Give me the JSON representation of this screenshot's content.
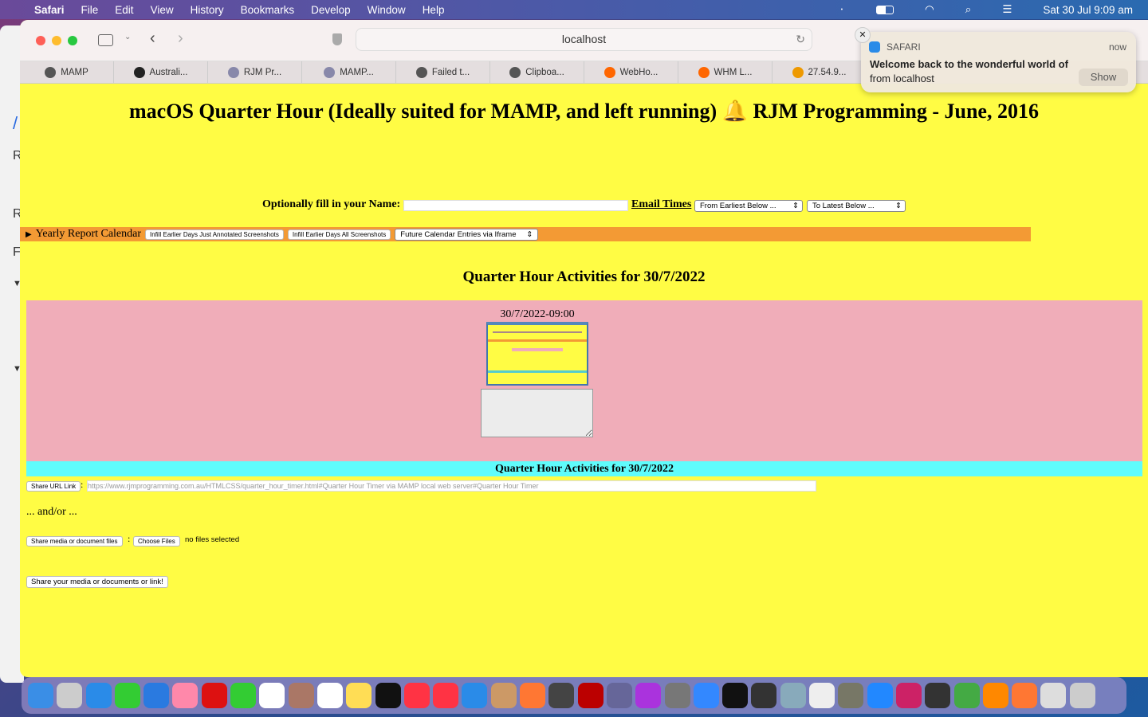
{
  "menubar": {
    "items": [
      "Safari",
      "File",
      "Edit",
      "View",
      "History",
      "Bookmarks",
      "Develop",
      "Window",
      "Help"
    ],
    "clock": "Sat 30 Jul  9:09 am"
  },
  "browser": {
    "url": "localhost",
    "tabs": [
      {
        "label": "MAMP",
        "icon": "mamp-icon",
        "color": "#555"
      },
      {
        "label": "Australi...",
        "icon": "s-icon",
        "color": "#222"
      },
      {
        "label": "RJM Pr...",
        "icon": "rjm-icon",
        "color": "#88a"
      },
      {
        "label": "MAMP...",
        "icon": "rjm-icon",
        "color": "#88a"
      },
      {
        "label": "Failed t...",
        "icon": "mamp-icon",
        "color": "#555"
      },
      {
        "label": "Clipboa...",
        "icon": "mamp-icon",
        "color": "#555"
      },
      {
        "label": "WebHo...",
        "icon": "cpanel-icon",
        "color": "#f60"
      },
      {
        "label": "WHM L...",
        "icon": "cpanel-icon",
        "color": "#f60"
      },
      {
        "label": "27.54.9...",
        "icon": "pma-icon",
        "color": "#e90"
      }
    ]
  },
  "notification": {
    "app": "SAFARI",
    "time": "now",
    "title": "Welcome back to the wonderful world of",
    "body": "from localhost",
    "show": "Show"
  },
  "page": {
    "title": "macOS Quarter Hour (Ideally suited for MAMP, and left running) 🔔 RJM Programming - June, 2016",
    "name_label": "Optionally fill in your Name:",
    "name_value": "",
    "email_link": "Email Times",
    "email_from": "From Earliest Below ...",
    "email_to": "To Latest Below ...",
    "calendar_label": "Yearly Report Calendar",
    "infill_annotated": "Infill Earlier Days Just Annotated Screenshots",
    "infill_all": "Infill Earlier Days All Screenshots",
    "future_select": "Future Calendar Entries via Iframe",
    "activities_heading": "Quarter Hour Activities for 30/7/2022",
    "entry_time": "30/7/2022-09:00",
    "cyan_heading": "Quarter Hour Activities for 30/7/2022",
    "share_url_btn": "Share URL Link",
    "share_url_value": "https://www.rjmprogramming.com.au/HTMLCSS/quarter_hour_timer.html#Quarter Hour Timer via MAMP local web server#Quarter Hour Timer",
    "andor": "... and/or ...",
    "share_media_btn": "Share media or document files",
    "choose_files": "Choose Files",
    "no_files": "no files selected",
    "share_submit": "Share your media or documents or link!",
    "colors": {
      "background": "#fffc44",
      "calendar_bar": "#f39a34",
      "entry_box": "#f0adb9",
      "cyan_bar": "#5ffcfc"
    }
  },
  "dock": [
    [
      "finder-icon",
      "#3a8ee6"
    ],
    [
      "launchpad-icon",
      "#ccc"
    ],
    [
      "safari-icon",
      "#2a8be8"
    ],
    [
      "messages-icon",
      "#3c3"
    ],
    [
      "mail-icon",
      "#2a7ae0"
    ],
    [
      "photos-icon",
      "#f8a"
    ],
    [
      "opera-icon",
      "#d11"
    ],
    [
      "facetime-icon",
      "#3c3"
    ],
    [
      "calendar-icon",
      "#fff"
    ],
    [
      "contacts-icon",
      "#a76"
    ],
    [
      "reminders-icon",
      "#fff"
    ],
    [
      "notes-icon",
      "#fd5"
    ],
    [
      "tv-icon",
      "#111"
    ],
    [
      "music-icon",
      "#f34"
    ],
    [
      "news-icon",
      "#f34"
    ],
    [
      "app-store-icon",
      "#2a8be8"
    ],
    [
      "paint-icon",
      "#c96"
    ],
    [
      "firefox-icon",
      "#f73"
    ],
    [
      "calculator-icon",
      "#444"
    ],
    [
      "filezilla-icon",
      "#b00"
    ],
    [
      "bbedit-icon",
      "#669"
    ],
    [
      "podcasts-icon",
      "#a3d"
    ],
    [
      "system-preferences-icon",
      "#777"
    ],
    [
      "xcode-icon",
      "#38f"
    ],
    [
      "terminal-icon",
      "#111"
    ],
    [
      "mamp-icon",
      "#333"
    ],
    [
      "preview-icon",
      "#8ab"
    ],
    [
      "document-icon",
      "#eee"
    ],
    [
      "gimp-icon",
      "#776"
    ],
    [
      "zoom-icon",
      "#28f"
    ],
    [
      "intellij-icon",
      "#c26"
    ],
    [
      "quicktime-icon",
      "#333"
    ],
    [
      "chrome-icon",
      "#4a4"
    ],
    [
      "books-icon",
      "#f80"
    ],
    [
      "firefox-dev-icon",
      "#f73"
    ],
    [
      "music-doc-icon",
      "#ddd"
    ],
    [
      "trash-icon",
      "#ccc"
    ]
  ]
}
